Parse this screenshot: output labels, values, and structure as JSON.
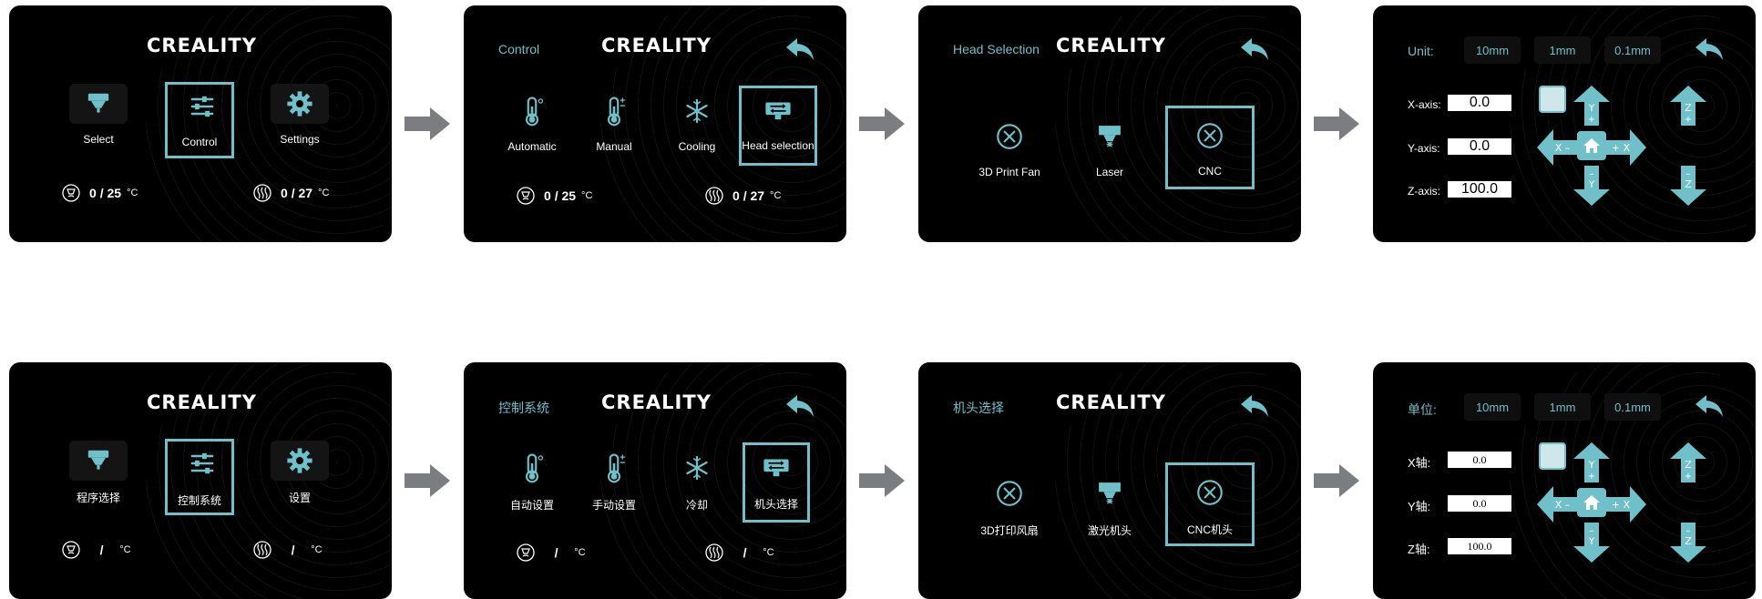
{
  "brand": "CREALITY",
  "colors": {
    "accent": "#6fc0c9",
    "panel_bg": "#000000",
    "arrow": "#7c7d80"
  },
  "en": {
    "home": {
      "tiles": [
        {
          "label": "Select",
          "icon": "nozzle-icon"
        },
        {
          "label": "Control",
          "icon": "sliders-icon"
        },
        {
          "label": "Settings",
          "icon": "gear-icon"
        }
      ],
      "temp_nozzle": {
        "value": "0",
        "sep": "/",
        "target": "25",
        "unit": "°C"
      },
      "temp_bed": {
        "value": "0",
        "sep": "/",
        "target": "27",
        "unit": "°C"
      }
    },
    "control": {
      "title": "Control",
      "tiles": [
        {
          "label": "Automatic",
          "icon": "thermometer-icon"
        },
        {
          "label": "Manual",
          "icon": "thermometer-plus-icon"
        },
        {
          "label": "Cooling",
          "icon": "snowflake-icon"
        },
        {
          "label": "Head selection",
          "icon": "head-swap-icon"
        }
      ],
      "temp_nozzle": {
        "value": "0",
        "sep": "/",
        "target": "25",
        "unit": "°C"
      },
      "temp_bed": {
        "value": "0",
        "sep": "/",
        "target": "27",
        "unit": "°C"
      }
    },
    "head": {
      "title": "Head Selection",
      "tiles": [
        {
          "label": "3D Print Fan",
          "icon": "x-circle-icon"
        },
        {
          "label": "Laser",
          "icon": "laser-icon"
        },
        {
          "label": "CNC",
          "icon": "x-circle-icon"
        }
      ]
    },
    "move": {
      "unit_label": "Unit:",
      "units": [
        "10mm",
        "1mm",
        "0.1mm"
      ],
      "axes": [
        {
          "label": "X-axis:",
          "value": "0.0"
        },
        {
          "label": "Y-axis:",
          "value": "0.0"
        },
        {
          "label": "Z-axis:",
          "value": "100.0"
        }
      ]
    }
  },
  "zh": {
    "home": {
      "tiles": [
        {
          "label": "程序选择",
          "icon": "nozzle-icon"
        },
        {
          "label": "控制系统",
          "icon": "sliders-icon"
        },
        {
          "label": "设置",
          "icon": "gear-icon"
        }
      ],
      "temp_nozzle": {
        "value": "",
        "sep": "/",
        "target": "",
        "unit": "°C"
      },
      "temp_bed": {
        "value": "",
        "sep": "/",
        "target": "",
        "unit": "°C"
      }
    },
    "control": {
      "title": "控制系统",
      "tiles": [
        {
          "label": "自动设置",
          "icon": "thermometer-icon"
        },
        {
          "label": "手动设置",
          "icon": "thermometer-plus-icon"
        },
        {
          "label": "冷却",
          "icon": "snowflake-icon"
        },
        {
          "label": "机头选择",
          "icon": "head-swap-icon"
        }
      ],
      "temp_nozzle": {
        "value": "",
        "sep": "/",
        "target": "",
        "unit": "°C"
      },
      "temp_bed": {
        "value": "",
        "sep": "/",
        "target": "",
        "unit": "°C"
      }
    },
    "head": {
      "title": "机头选择",
      "tiles": [
        {
          "label": "3D打印风扇",
          "icon": "x-circle-icon"
        },
        {
          "label": "激光机头",
          "icon": "laser-icon"
        },
        {
          "label": "CNC机头",
          "icon": "x-circle-icon"
        }
      ]
    },
    "move": {
      "unit_label": "单位:",
      "units": [
        "10mm",
        "1mm",
        "0.1mm"
      ],
      "axes": [
        {
          "label": "X轴:",
          "value": "0.0"
        },
        {
          "label": "Y轴:",
          "value": "0.0"
        },
        {
          "label": "Z轴:",
          "value": "100.0"
        }
      ]
    }
  },
  "jog": {
    "x_minus": "X –",
    "x_plus": "+ X",
    "y_plus_top": "Y",
    "y_plus_sign": "+",
    "y_minus_sign": "–",
    "y_minus_bottom": "Y",
    "z_plus_top": "Z",
    "z_plus_sign": "+",
    "z_minus_sign": "–",
    "z_minus_bottom": "Z"
  }
}
